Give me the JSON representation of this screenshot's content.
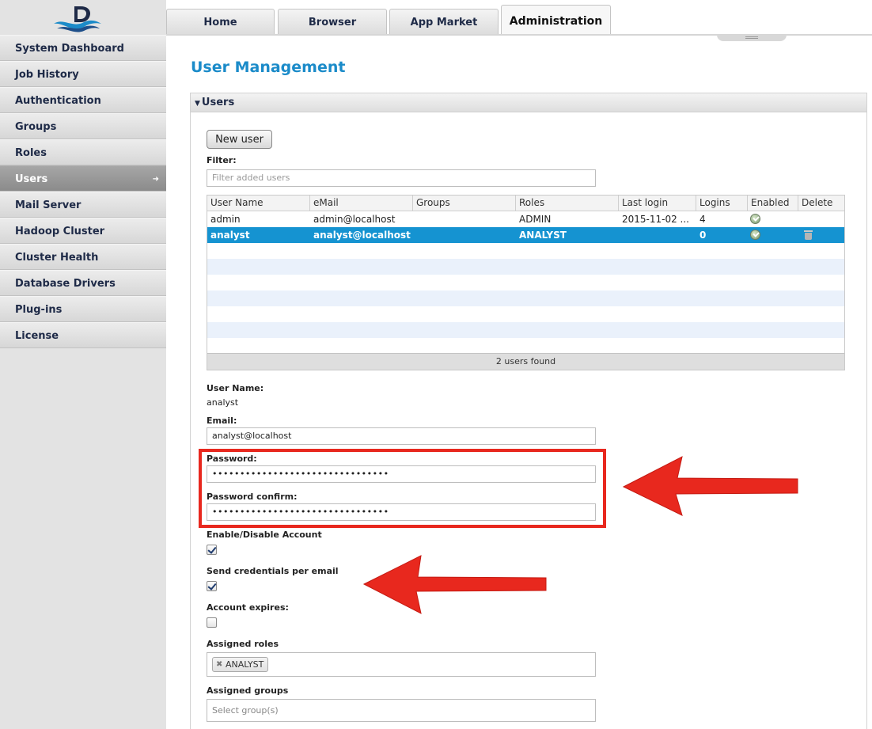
{
  "sidebar": {
    "items": [
      {
        "label": "System Dashboard"
      },
      {
        "label": "Job History"
      },
      {
        "label": "Authentication"
      },
      {
        "label": "Groups"
      },
      {
        "label": "Roles"
      },
      {
        "label": "Users",
        "active": true
      },
      {
        "label": "Mail Server"
      },
      {
        "label": "Hadoop Cluster"
      },
      {
        "label": "Cluster Health"
      },
      {
        "label": "Database Drivers"
      },
      {
        "label": "Plug-ins"
      },
      {
        "label": "License"
      }
    ]
  },
  "tabs": [
    {
      "label": "Home"
    },
    {
      "label": "Browser"
    },
    {
      "label": "App Market"
    },
    {
      "label": "Administration",
      "active": true
    }
  ],
  "page": {
    "title": "User Management"
  },
  "users_panel": {
    "header": "Users",
    "new_user_label": "New user",
    "filter_label": "Filter:",
    "filter_placeholder": "Filter added users",
    "table": {
      "columns": [
        "User Name",
        "eMail",
        "Groups",
        "Roles",
        "Last login",
        "Logins",
        "Enabled",
        "Delete"
      ],
      "rows": [
        {
          "user": "admin",
          "email": "admin@localhost",
          "groups": "",
          "roles": "ADMIN",
          "last_login": "2015-11-02 ...",
          "logins": "4",
          "enabled": true,
          "selected": false
        },
        {
          "user": "analyst",
          "email": "analyst@localhost",
          "groups": "",
          "roles": "ANALYST",
          "last_login": "",
          "logins": "0",
          "enabled": true,
          "selected": true
        }
      ],
      "footer": "2 users found"
    }
  },
  "form": {
    "username_label": "User Name:",
    "username_value": "analyst",
    "email_label": "Email:",
    "email_value": "analyst@localhost",
    "password_label": "Password:",
    "password_value": "••••••••••••••••••••••••••••••••",
    "password_confirm_label": "Password confirm:",
    "password_confirm_value": "••••••••••••••••••••••••••••••••",
    "enable_label": "Enable/Disable Account",
    "enable_checked": true,
    "send_creds_label": "Send credentials per email",
    "send_creds_checked": true,
    "expires_label": "Account expires:",
    "expires_checked": false,
    "roles_label": "Assigned roles",
    "roles": [
      "ANALYST"
    ],
    "groups_label": "Assigned groups",
    "groups_placeholder": "Select group(s)"
  },
  "colors": {
    "accent": "#1b8bc9",
    "selected_row": "#1593d1",
    "annotation": "#e8281e"
  }
}
